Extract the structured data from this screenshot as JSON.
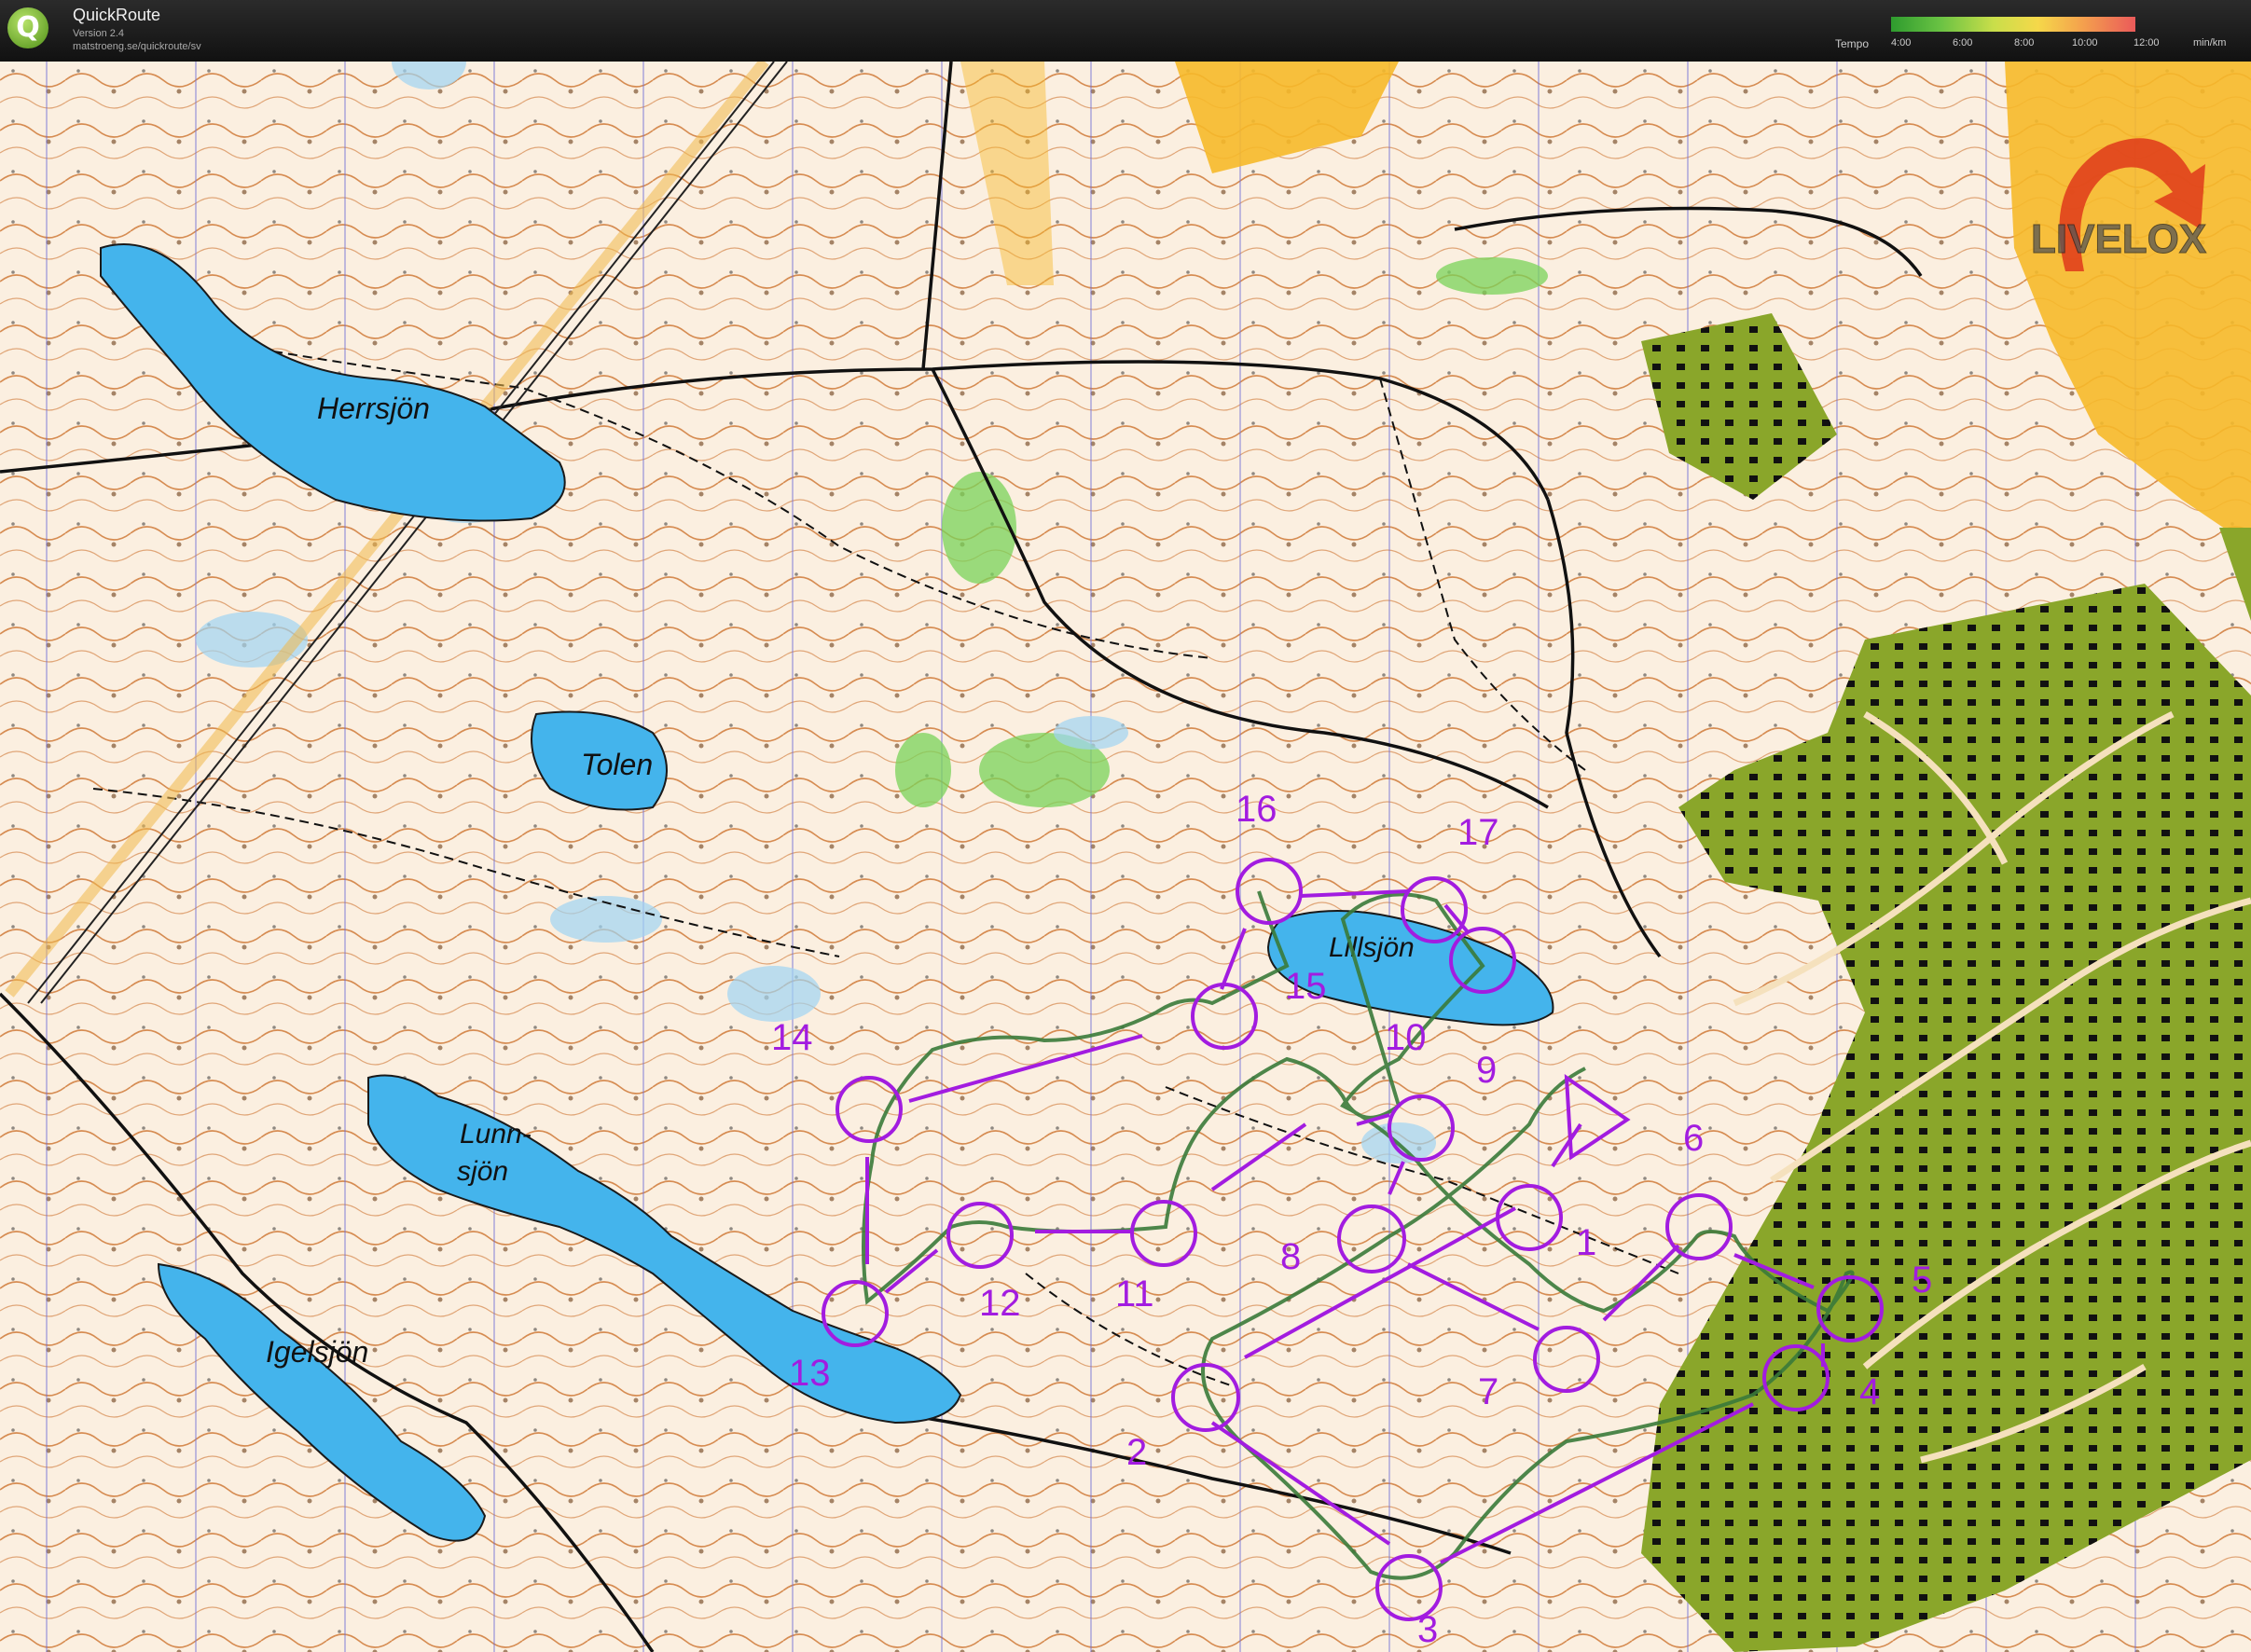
{
  "app": {
    "title": "QuickRoute",
    "version": "Version 2.4",
    "url": "matstroeng.se/quickroute/sv",
    "logo_letter": "Q"
  },
  "tempo_legend": {
    "label": "Tempo",
    "ticks": [
      "4:00",
      "6:00",
      "8:00",
      "10:00",
      "12:00"
    ],
    "unit": "min/km",
    "colors": [
      "#2e9b2e",
      "#69c243",
      "#c9de4a",
      "#f5d84a",
      "#f4a24d",
      "#ea5a5a"
    ]
  },
  "map": {
    "watermark": "LIVELOX",
    "lakes": [
      {
        "id": "herrsjon",
        "name": "Herrsjön"
      },
      {
        "id": "tolen",
        "name": "Tolen"
      },
      {
        "id": "lunnsjon",
        "name": "Lunn-\nsjön",
        "lines": [
          "Lunn-",
          "sjön"
        ]
      },
      {
        "id": "igelsjon",
        "name": "Igelsjön"
      },
      {
        "id": "lillsjon",
        "name": "Lillsjön"
      }
    ],
    "controls": [
      "1",
      "2",
      "3",
      "4",
      "5",
      "6",
      "7",
      "8",
      "9",
      "10",
      "11",
      "12",
      "13",
      "14",
      "15",
      "16",
      "17"
    ],
    "course_sequence": [
      "start",
      "1",
      "2",
      "3",
      "4",
      "5",
      "6",
      "7",
      "8",
      "9",
      "10",
      "11",
      "12",
      "13",
      "14",
      "15",
      "16",
      "17"
    ],
    "colors": {
      "terrain": "#fbefe0",
      "water": "#44b4ec",
      "open_land": "#f7b92a",
      "green_vegetation": "#8aa62a",
      "contour": "#c96a22",
      "course": "#a21ce0",
      "route": "#3a7a3a"
    }
  }
}
